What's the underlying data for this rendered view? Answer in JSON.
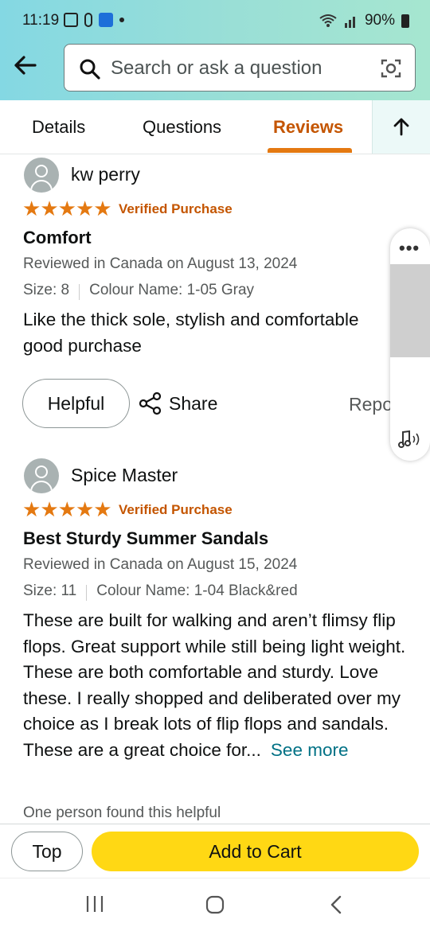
{
  "status": {
    "time": "11:19",
    "battery": "90%"
  },
  "search": {
    "placeholder": "Search or ask a question"
  },
  "tabs": [
    {
      "label": "Details"
    },
    {
      "label": "Questions"
    },
    {
      "label": "Reviews",
      "active": true
    }
  ],
  "reviews": [
    {
      "name": "kw perry",
      "rating": 5,
      "verified": "Verified Purchase",
      "title": "Comfort",
      "date": "Reviewed in Canada on August 13, 2024",
      "size": "Size: 8",
      "colour": "Colour Name: 1-05 Gray",
      "body_lines": [
        "Like the thick sole, stylish and comfortable",
        "good purchase"
      ],
      "helpful_label": "Helpful",
      "share_label": "Share",
      "report_label": "Report"
    },
    {
      "name": "Spice Master",
      "rating": 5,
      "verified": "Verified Purchase",
      "title": "Best Sturdy Summer Sandals",
      "date": "Reviewed in Canada on August 15, 2024",
      "size": "Size: 11",
      "colour": "Colour Name: 1-04 Black&red",
      "body": "These are built for walking and aren’t flimsy flip flops. Great support while still being light weight. These are both comfortable and sturdy. Love these. I really shopped and deliberated over my choice as I break lots of flip flops and sandals. These are a great choice for...",
      "see_more": "See more",
      "found_helpful": "One person found this helpful"
    }
  ],
  "bottom": {
    "top_label": "Top",
    "cart_label": "Add to Cart"
  },
  "colors": {
    "accent": "#e47911",
    "cart": "#ffd814",
    "link": "#007185",
    "header": "#9adfd6"
  }
}
